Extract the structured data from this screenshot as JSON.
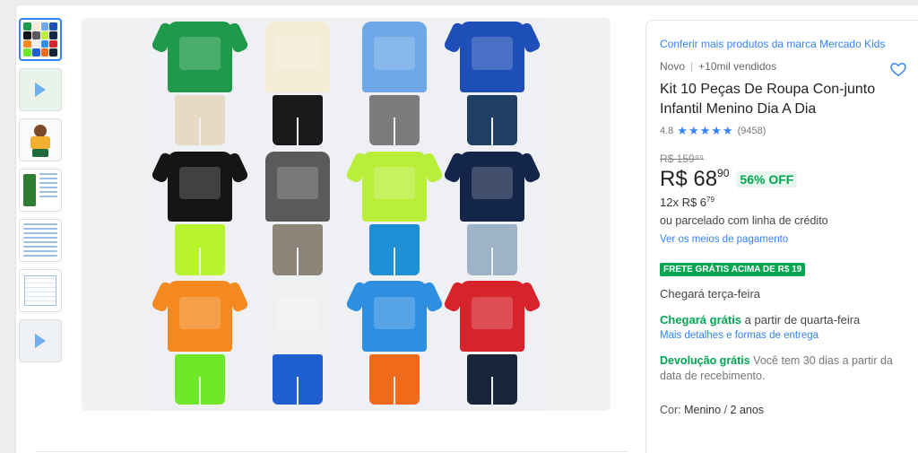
{
  "gallery": {
    "thumbnails": [
      {
        "name": "thumb-collage",
        "kind": "collage"
      },
      {
        "name": "thumb-video-1",
        "kind": "video"
      },
      {
        "name": "thumb-child-photo",
        "kind": "photo"
      },
      {
        "name": "thumb-info-card",
        "kind": "doc"
      },
      {
        "name": "thumb-text-card",
        "kind": "doc"
      },
      {
        "name": "thumb-size-table",
        "kind": "table"
      },
      {
        "name": "thumb-video-2",
        "kind": "video"
      }
    ],
    "outfits": [
      {
        "shirt": "#1f9a4a",
        "shorts": "#e6d9c6",
        "tank": false
      },
      {
        "shirt": "#f4ecd6",
        "shorts": "#1a1a1a",
        "tank": true
      },
      {
        "shirt": "#6ea8e8",
        "shorts": "#7c7c7c",
        "tank": true
      },
      {
        "shirt": "#1e4fb8",
        "shorts": "#1f3f64",
        "tank": false
      },
      {
        "shirt": "#151515",
        "shorts": "#b9f52f",
        "tank": false
      },
      {
        "shirt": "#5a5a5a",
        "shorts": "#8c8478",
        "tank": true
      },
      {
        "shirt": "#b9ef3a",
        "shorts": "#1f8fd6",
        "tank": false
      },
      {
        "shirt": "#14254a",
        "shorts": "#9fb3c8",
        "tank": false
      },
      {
        "shirt": "#f4891f",
        "shorts": "#6fe82a",
        "tank": false
      },
      {
        "shirt": "#f0f0f0",
        "shorts": "#1f5fd0",
        "tank": true
      },
      {
        "shirt": "#2e8fe0",
        "shorts": "#f06a1a",
        "tank": false
      },
      {
        "shirt": "#d7232b",
        "shorts": "#17243a",
        "tank": false
      }
    ]
  },
  "product": {
    "brand_link": "Conferir mais produtos da marca Mercado Kids",
    "condition": "Novo",
    "sold": "+10mil vendidos",
    "title": "Kit 10 Peças De Roupa Con-junto Infantil Menino Dia A Dia",
    "rating_value": "4.8",
    "stars": "★★★★★",
    "rating_count": "(9458)",
    "old_price": "R$ 159⁹⁹",
    "price_main": "R$ 68",
    "price_cents": "90",
    "discount": "56% OFF",
    "installments_main": "12x R$ 6",
    "installments_cents": "79",
    "credit_text": "ou parcelado com linha de crédito",
    "payment_link": "Ver os meios de pagamento",
    "free_shipping_badge": "FRETE GRÁTIS ACIMA DE R$ 19",
    "arrival_text": "Chegará terça-feira",
    "free_arrival_highlight": "Chegará grátis",
    "free_arrival_rest": " a partir de quarta-feira",
    "delivery_link": "Mais detalhes e formas de entrega",
    "returns_highlight": "Devolução grátis",
    "returns_rest": " Você tem 30 dias a partir da data de recebimento.",
    "variant_label": "Cor: ",
    "variant_value": "Menino",
    "variant_sep": " / ",
    "variant_size": "2 anos"
  },
  "colors": {
    "accent": "#3483fa",
    "success": "#00a650"
  }
}
